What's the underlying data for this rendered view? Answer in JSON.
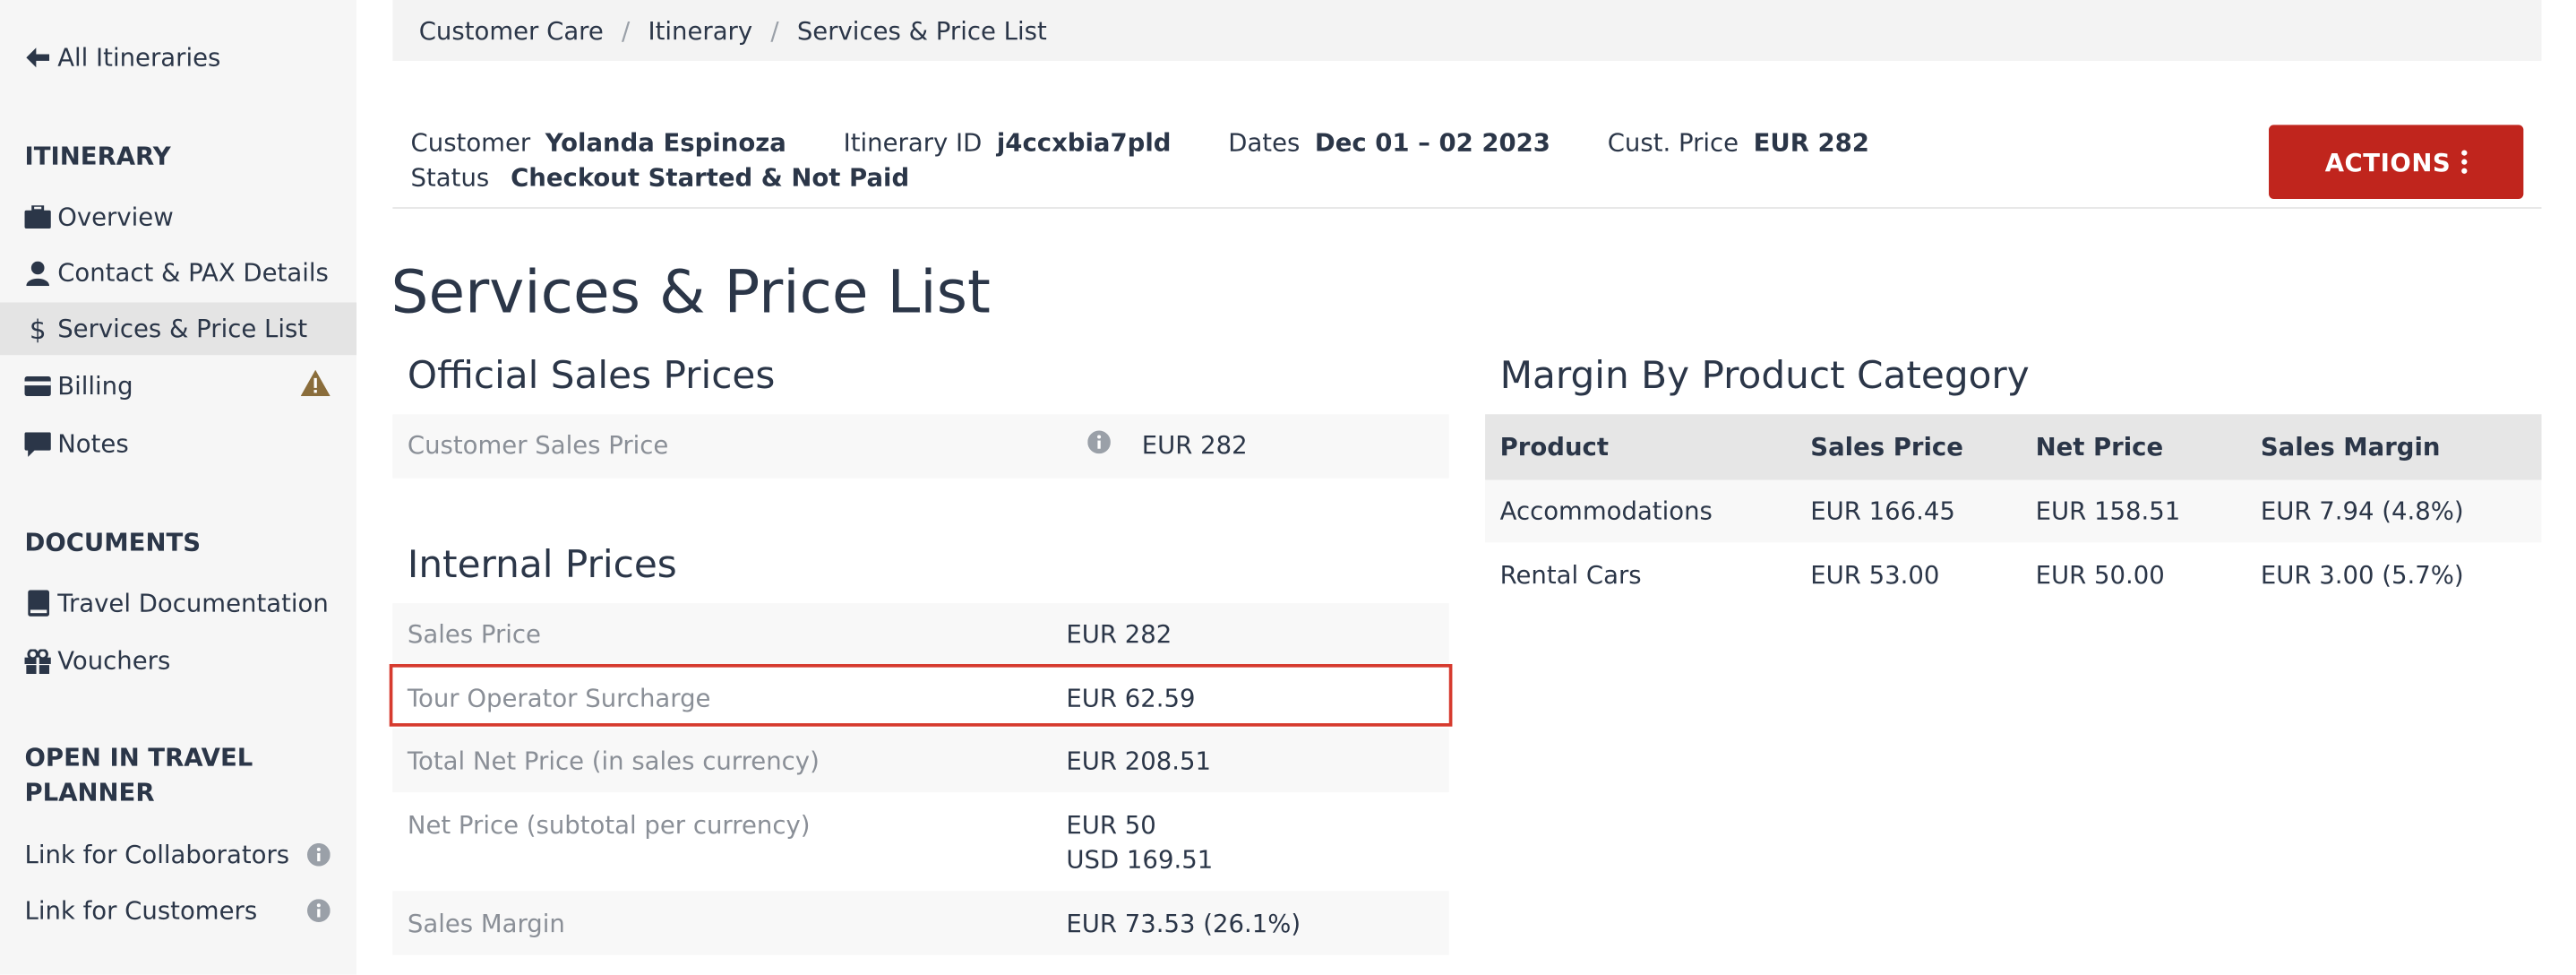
{
  "sidebar": {
    "back_label": "All Itineraries",
    "itinerary_heading": "ITINERARY",
    "itinerary_items": [
      {
        "label": "Overview",
        "icon": "briefcase-icon"
      },
      {
        "label": "Contact & PAX Details",
        "icon": "user-icon"
      },
      {
        "label": "Services & Price List",
        "icon": "dollar-icon",
        "active": true
      },
      {
        "label": "Billing",
        "icon": "credit-card-icon",
        "warning_icon": "warning-icon"
      },
      {
        "label": "Notes",
        "icon": "comment-icon"
      }
    ],
    "documents_heading": "DOCUMENTS",
    "document_items": [
      {
        "label": "Travel Documentation",
        "icon": "book-icon"
      },
      {
        "label": "Vouchers",
        "icon": "gift-icon"
      }
    ],
    "planner_heading": "OPEN IN TRAVEL PLANNER",
    "planner_items": [
      {
        "label": "Link for Collaborators",
        "icon": "info-icon"
      },
      {
        "label": "Link for Customers",
        "icon": "info-icon"
      }
    ]
  },
  "breadcrumb": [
    "Customer Care",
    "Itinerary",
    "Services & Price List"
  ],
  "header": {
    "customer_label": "Customer",
    "customer_value": "Yolanda Espinoza",
    "itinerary_id_label": "Itinerary ID",
    "itinerary_id_value": "j4ccxbia7pld",
    "dates_label": "Dates",
    "dates_value": "Dec 01 – 02 2023",
    "cust_price_label": "Cust. Price",
    "cust_price_value": "EUR 282",
    "status_label": "Status",
    "status_value": "Checkout Started & Not Paid",
    "actions_label": "ACTIONS"
  },
  "page_title": "Services & Price List",
  "official_sales": {
    "title": "Official Sales Prices",
    "rows": [
      {
        "label": "Customer Sales Price",
        "value": "EUR 282"
      }
    ]
  },
  "internal_prices": {
    "title": "Internal Prices",
    "rows": [
      {
        "label": "Sales Price",
        "value": "EUR 282"
      },
      {
        "label": "Tour Operator Surcharge",
        "value": "EUR 62.59"
      },
      {
        "label": "Total Net Price (in sales currency)",
        "value": "EUR 208.51"
      },
      {
        "label": "Net Price (subtotal per currency)",
        "value": "EUR 50",
        "value2": "USD 169.51"
      },
      {
        "label": "Sales Margin",
        "value": "EUR 73.53 (26.1%)"
      }
    ]
  },
  "margin_table": {
    "title": "Margin By Product Category",
    "headers": [
      "Product",
      "Sales Price",
      "Net Price",
      "Sales Margin"
    ],
    "rows": [
      [
        "Accommodations",
        "EUR 166.45",
        "EUR 158.51",
        "EUR 7.94 (4.8%)"
      ],
      [
        "Rental Cars",
        "EUR 53.00",
        "EUR 50.00",
        "EUR 3.00 (5.7%)"
      ]
    ]
  },
  "colors": {
    "accent": "#c0251d",
    "highlight": "#d63a2e",
    "text": "#2b3648",
    "muted": "#8a8f97",
    "warning": "#8a6d3b"
  }
}
